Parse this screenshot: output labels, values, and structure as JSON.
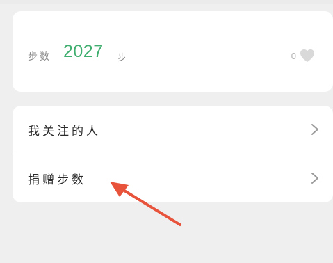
{
  "steps_card": {
    "label": "步数",
    "value": "2027",
    "unit": "步",
    "like_count": "0",
    "heart_icon": "heart-icon"
  },
  "menu": {
    "items": [
      {
        "label": "我关注的人",
        "icon": "chevron-right-icon"
      },
      {
        "label": "捐赠步数",
        "icon": "chevron-right-icon"
      }
    ]
  },
  "colors": {
    "background": "#efefef",
    "card": "#ffffff",
    "steps_value": "#3fae6f",
    "annotation_arrow": "#e8533c"
  }
}
